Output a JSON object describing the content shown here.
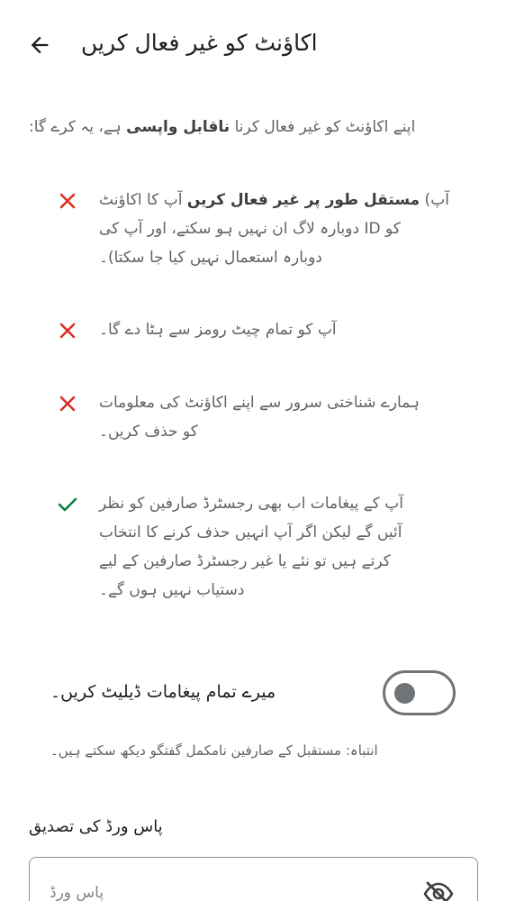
{
  "header": {
    "title": "اکاؤنٹ کو غیر فعال کریں",
    "back_icon": "arrow-back-icon"
  },
  "intro": {
    "before": "اپنے اکاؤنٹ کو غیر فعال کرنا ",
    "bold": "ناقابل واپسی",
    "after": " ہے، یہ کرے گا:"
  },
  "consequences": [
    {
      "icon": "cross-icon",
      "color": "#d93025",
      "line1_before": "آپ) ",
      "line1_bold": "مستقل طور پر غیر فعال کریں",
      "line1_after": " آپ کا اکاؤنٹ",
      "line2": "کو ID دوبارہ لاگ ان نہیں ہو سکتے، اور آپ کی",
      "line3": "دوبارہ استعمال نہیں کیا جا سکتا)۔"
    },
    {
      "icon": "cross-icon",
      "color": "#d93025",
      "line1": "آپ کو تمام چیٹ رومز سے ہٹا دے گا۔"
    },
    {
      "icon": "cross-icon",
      "color": "#d93025",
      "line1": "ہمارے شناختی سرور سے اپنے اکاؤنٹ کی معلومات",
      "line2": "کو حذف کریں۔"
    },
    {
      "icon": "check-icon",
      "color": "#0b8043",
      "line1": "آپ کے پیغامات اب بھی رجسٹرڈ صارفین کو نظر",
      "line2": "آئیں گے لیکن اگر آپ انہیں حذف کرنے کا انتخاب",
      "line3": "کرتے ہیں تو نئے یا غیر رجسٹرڈ صارفین کے لیے",
      "line4": "دستیاب نہیں ہوں گے۔"
    }
  ],
  "toggle": {
    "label": "میرے تمام پیغامات ڈیلیٹ کریں۔",
    "state": "off"
  },
  "warning": "انتباہ: مستقبل کے صارفین نامکمل گفتگو دیکھ سکتے ہیں۔",
  "password": {
    "label": "پاس ورڈ کی تصدیق",
    "placeholder": "پاس ورڈ",
    "visibility_icon": "eye-off-icon"
  },
  "colors": {
    "error": "#d93025",
    "success": "#0b8043",
    "muted_text": "#5f6368"
  }
}
